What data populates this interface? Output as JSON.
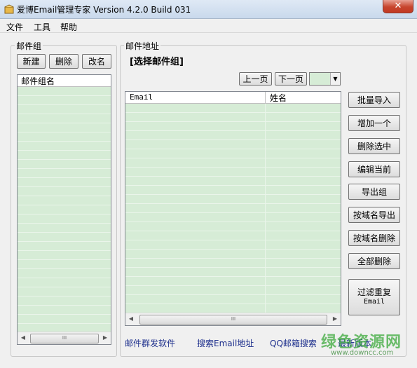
{
  "window": {
    "title": "爱博Email管理专家 Version 4.2.0 Build 031",
    "close_glyph": "✕"
  },
  "menu": [
    "文件",
    "工具",
    "帮助"
  ],
  "groups_panel": {
    "title": "邮件组",
    "buttons": {
      "new": "新建",
      "delete": "删除",
      "rename": "改名"
    },
    "column_header": "邮件组名",
    "scroll_thumb": "III"
  },
  "address_panel": {
    "title": "邮件地址",
    "selected_group": "[选择邮件组]",
    "prev_page": "上一页",
    "next_page": "下一页",
    "page_select": "",
    "columns": [
      "Email",
      "姓名"
    ],
    "scroll_thumb": "III",
    "actions": [
      "批量导入",
      "增加一个",
      "删除选中",
      "编辑当前",
      "导出组",
      "按域名导出",
      "按域名删除",
      "全部删除"
    ],
    "filter_button": {
      "line1": "过滤重复",
      "line2": "Email"
    }
  },
  "footer_links": [
    "邮件群发软件",
    "搜索Email地址",
    "QQ邮箱搜索",
    "最新版本"
  ],
  "watermark": {
    "main": "绿色资源网",
    "sub": "www.downcc.com"
  },
  "colors": {
    "grid_bg": "#d6ecd6",
    "link": "#1c2e8c"
  }
}
